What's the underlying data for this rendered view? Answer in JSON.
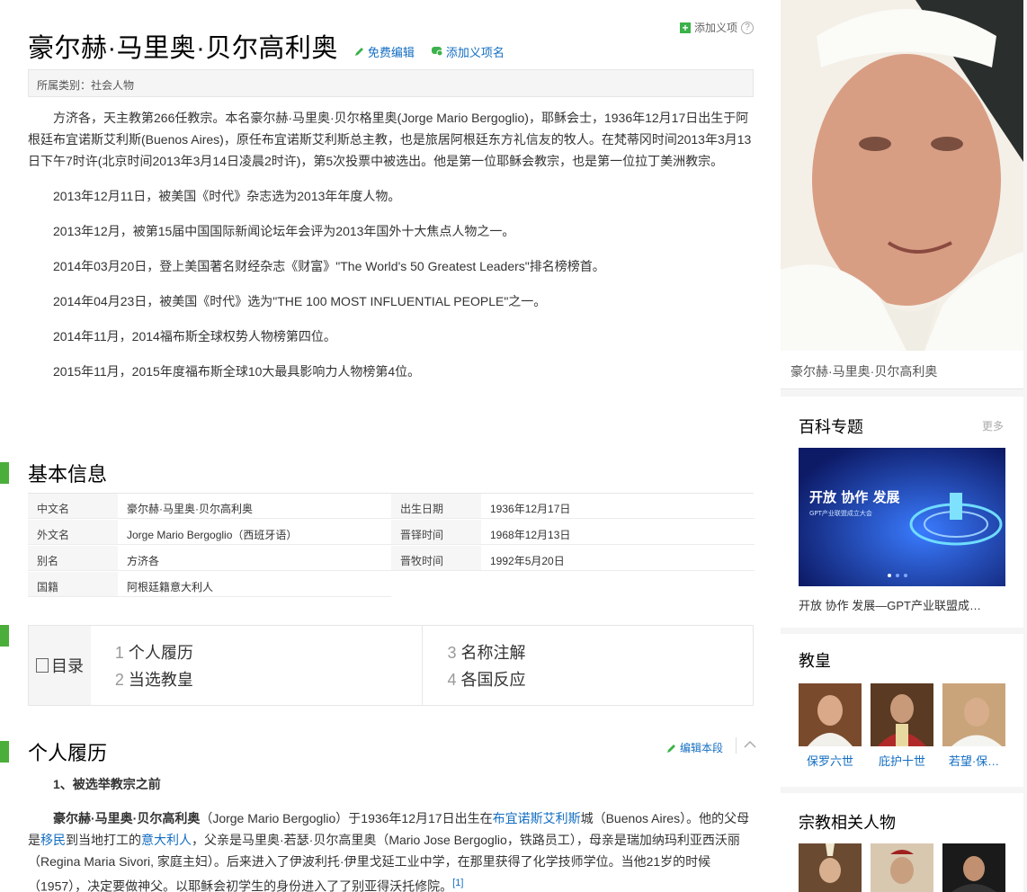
{
  "title": "豪尔赫·马里奥·贝尔高利奥",
  "title_links": {
    "edit": "免费编辑",
    "add_name": "添加义项名"
  },
  "add_sense": "添加义项",
  "help": "?",
  "category": "所属类别：社会人物",
  "summary": {
    "lead": "方济各，天主教第266任教宗。本名豪尔赫·马里奥·贝尔格里奥(Jorge Mario Bergoglio)，耶稣会士，1936年12月17日出生于阿根廷布宜诺斯艾利斯(Buenos Aires)，原任布宜诺斯艾利斯总主教，也是旅居阿根廷东方礼信友的牧人。在梵蒂冈时间2013年3月13日下午7时许(北京时间2013年3月14日凌晨2时许)，第5次投票中被选出。他是第一位耶稣会教宗，也是第一位拉丁美洲教宗。",
    "items": [
      "2013年12月11日，被美国《时代》杂志选为2013年年度人物。",
      "2013年12月，被第15届中国国际新闻论坛年会评为2013年国外十大焦点人物之一。",
      "2014年03月20日，登上美国著名财经杂志《财富》\"The World's 50 Greatest Leaders\"排名榜榜首。",
      "2014年04月23日，被美国《时代》选为\"THE 100 MOST INFLUENTIAL PEOPLE\"之一。",
      "2014年11月，2014福布斯全球权势人物榜第四位。",
      "2015年11月，2015年度福布斯全球10大最具影响力人物榜第4位。"
    ]
  },
  "basic_info": {
    "heading": "基本信息",
    "rows": [
      {
        "k1": "中文名",
        "v1": "豪尔赫·马里奥·贝尔高利奥",
        "k2": "出生日期",
        "v2": "1936年12月17日"
      },
      {
        "k1": "外文名",
        "v1": "Jorge Mario Bergoglio（西班牙语）",
        "k2": "晋铎时间",
        "v2": "1968年12月13日"
      },
      {
        "k1": "别名",
        "v1": "方济各",
        "k2": "晋牧时间",
        "v2": "1992年5月20日"
      },
      {
        "k1": "国籍",
        "v1": "阿根廷籍意大利人"
      }
    ]
  },
  "toc": {
    "label": "目录",
    "items": [
      {
        "num": "1",
        "label": "个人履历"
      },
      {
        "num": "2",
        "label": "当选教皇"
      },
      {
        "num": "3",
        "label": "名称注解"
      },
      {
        "num": "4",
        "label": "各国反应"
      }
    ]
  },
  "section1": {
    "heading": "个人履历",
    "edit": "编辑本段",
    "sub": "1、被选举教宗之前",
    "p1_name": "豪尔赫·马里奥·贝尔高利奥",
    "p1_a": "（Jorge Mario Bergoglio）于1936年12月17日出生在",
    "p1_link1": "布宜诺斯艾利斯",
    "p1_b": "城（Buenos Aires）。他的父母是",
    "p1_link2": "移民",
    "p1_c": "到当地打工的",
    "p1_link3": "意大利人",
    "p1_d": "，父亲是马里奥·若瑟·贝尔高里奥（Mario Jose Bergoglio，铁路员工），母亲是瑞加纳玛利亚西沃丽（Regina Maria Sivori, 家庭主妇）。后来进入了伊波利托·伊里戈延工业中学，在那里获得了化学技师学位。当他21岁的时候（1957），决定要做神父。以耶稣会初学生的身份进入了了别亚得沃托修院。",
    "cite": "[1]"
  },
  "sidebar": {
    "caption": "豪尔赫·马里奥·贝尔高利奥",
    "topic": {
      "title": "百科专题",
      "more": "更多",
      "banner_caption": "开放 协作 发展—GPT产业联盟成…",
      "banner_head": "开放 协作 发展",
      "banner_sub": "GPT产业联盟成立大会"
    },
    "popes": {
      "title": "教皇",
      "items": [
        "保罗六世",
        "庇护十世",
        "若望·保…"
      ]
    },
    "related": {
      "title": "宗教相关人物"
    }
  },
  "colors": {
    "accent_green": "#4cae3a",
    "link_blue": "#136ec2"
  }
}
